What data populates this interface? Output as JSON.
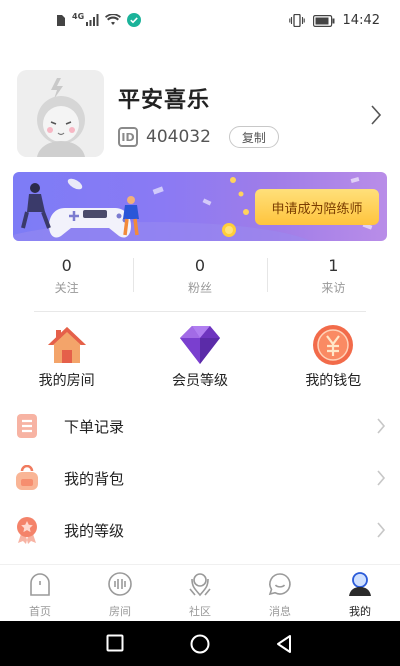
{
  "status_bar": {
    "time": "14:42",
    "network": "4G",
    "icons": [
      "sim-icon",
      "signal-icon",
      "wifi-icon",
      "verified-icon",
      "vibrate-icon",
      "battery-icon"
    ]
  },
  "profile": {
    "nickname": "平安喜乐",
    "id_badge": "ID",
    "user_id": "404032",
    "copy_label": "复制"
  },
  "banner": {
    "cta_label": "申请成为陪练师",
    "colors": {
      "start": "#7d7cf6",
      "end": "#b98de8",
      "cta": "#ffc43d"
    }
  },
  "stats": [
    {
      "value": "0",
      "label": "关注"
    },
    {
      "value": "0",
      "label": "粉丝"
    },
    {
      "value": "1",
      "label": "来访"
    }
  ],
  "quick_links": [
    {
      "label": "我的房间",
      "icon": "house-icon"
    },
    {
      "label": "会员等级",
      "icon": "gem-icon"
    },
    {
      "label": "我的钱包",
      "icon": "yuan-coin-icon"
    }
  ],
  "menu": [
    {
      "label": "下单记录",
      "icon": "order-list-icon"
    },
    {
      "label": "我的背包",
      "icon": "backpack-icon"
    },
    {
      "label": "我的等级",
      "icon": "level-medal-icon"
    }
  ],
  "tabs": [
    {
      "label": "首页",
      "icon": "home-icon",
      "active": false
    },
    {
      "label": "房间",
      "icon": "room-icon",
      "active": false
    },
    {
      "label": "社区",
      "icon": "community-icon",
      "active": false
    },
    {
      "label": "消息",
      "icon": "message-icon",
      "active": false
    },
    {
      "label": "我的",
      "icon": "profile-icon",
      "active": true
    }
  ],
  "system_nav": [
    "recents-icon",
    "home-circle-icon",
    "back-icon"
  ]
}
